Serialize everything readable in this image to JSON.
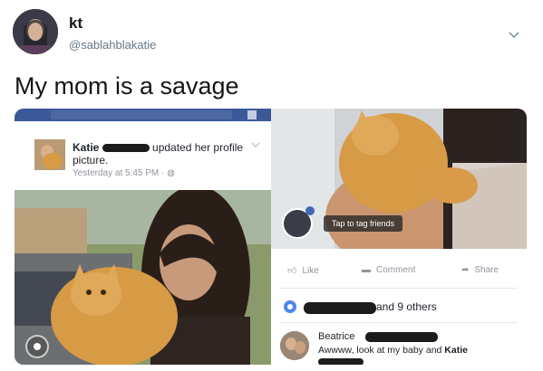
{
  "tweet": {
    "name": "kt",
    "handle": "@sablahblakatie",
    "text": "My mom is a savage"
  },
  "left_screenshot": {
    "post_name": "Katie",
    "post_action": "updated her profile picture.",
    "post_time": "Yesterday at 5:45 PM · "
  },
  "right_screenshot": {
    "tag_hint": "Tap to tag friends",
    "actions": {
      "like": "Like",
      "comment": "Comment",
      "share": "Share"
    },
    "reactions_text": "and 9 others",
    "comment": {
      "name": "Beatrice",
      "text_before": "Awwww, look at my baby and ",
      "text_bold": "Katie"
    }
  },
  "colors": {
    "facebook_blue": "#3b5998",
    "link_blue": "#4267b2"
  }
}
